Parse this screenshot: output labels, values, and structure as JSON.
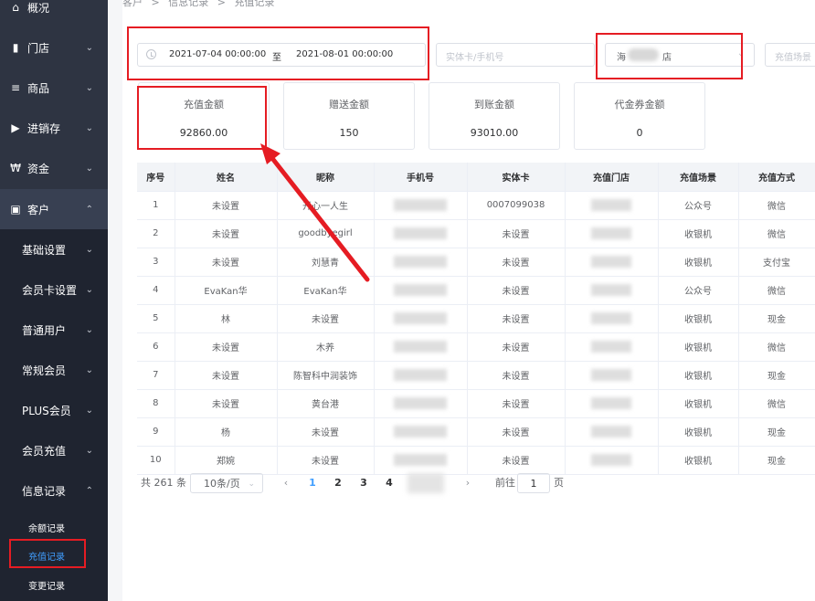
{
  "sidebar": {
    "items": [
      {
        "icon": "home-icon",
        "glyph": "⌂",
        "label": "概况"
      },
      {
        "icon": "store-icon",
        "glyph": "▮",
        "label": "门店",
        "chev": "⌄"
      },
      {
        "icon": "list-icon",
        "glyph": "≡",
        "label": "商品",
        "chev": "⌄"
      },
      {
        "icon": "truck-icon",
        "glyph": "▶",
        "label": "进销存",
        "chev": "⌄"
      },
      {
        "icon": "won-icon",
        "glyph": "₩",
        "label": "资金",
        "chev": "⌄"
      },
      {
        "icon": "id-card-icon",
        "glyph": "▣",
        "label": "客户",
        "chev": "⌃"
      }
    ],
    "sub_items": [
      {
        "label": "基础设置",
        "chev": "⌄"
      },
      {
        "label": "会员卡设置",
        "chev": "⌄"
      },
      {
        "label": "普通用户",
        "chev": "⌄"
      },
      {
        "label": "常规会员",
        "chev": "⌄"
      },
      {
        "label": "PLUS会员",
        "chev": "⌄"
      },
      {
        "label": "会员充值",
        "chev": "⌄"
      },
      {
        "label": "信息记录",
        "chev": "⌃"
      }
    ],
    "leaves": [
      {
        "label": "余额记录"
      },
      {
        "label": "充值记录"
      },
      {
        "label": "变更记录"
      }
    ]
  },
  "breadcrumb": [
    "客户",
    ">",
    "信息记录",
    ">",
    "充值记录"
  ],
  "filters": {
    "date_start": "2021-07-04 00:00:00",
    "date_sep": "至",
    "date_end": "2021-08-01 00:00:00",
    "card_placeholder": "实体卡/手机号",
    "store_value_prefix": "海",
    "store_value_suffix": "店",
    "scene_placeholder": "充值场景"
  },
  "stats": [
    {
      "title": "充值金额",
      "value": "92860.00"
    },
    {
      "title": "赠送金额",
      "value": "150"
    },
    {
      "title": "到账金额",
      "value": "93010.00"
    },
    {
      "title": "代金券金额",
      "value": "0"
    }
  ],
  "table": {
    "headers": [
      "序号",
      "姓名",
      "昵称",
      "手机号",
      "实体卡",
      "充值门店",
      "充值场景",
      "充值方式"
    ],
    "rows": [
      [
        "1",
        "未设置",
        "开心一人生",
        "",
        "0007099038",
        "",
        "公众号",
        "微信"
      ],
      [
        "2",
        "未设置",
        "goodbyegirl",
        "",
        "未设置",
        "",
        "收银机",
        "微信"
      ],
      [
        "3",
        "未设置",
        "刘慧青",
        "",
        "未设置",
        "",
        "收银机",
        "支付宝"
      ],
      [
        "4",
        "EvaKan华",
        "EvaKan华",
        "",
        "未设置",
        "",
        "公众号",
        "微信"
      ],
      [
        "5",
        "林",
        "未设置",
        "",
        "未设置",
        "",
        "收银机",
        "现金"
      ],
      [
        "6",
        "未设置",
        "木养",
        "",
        "未设置",
        "",
        "收银机",
        "微信"
      ],
      [
        "7",
        "未设置",
        "陈智科中润装饰",
        "",
        "未设置",
        "",
        "收银机",
        "现金"
      ],
      [
        "8",
        "未设置",
        "黄台港",
        "",
        "未设置",
        "",
        "收银机",
        "微信"
      ],
      [
        "9",
        "杨",
        "未设置",
        "",
        "未设置",
        "",
        "收银机",
        "现金"
      ],
      [
        "10",
        "郑婉",
        "未设置",
        "",
        "未设置",
        "",
        "收银机",
        "现金"
      ]
    ]
  },
  "pagination": {
    "total": "共 261 条",
    "page_size": "10条/页",
    "pages": [
      "1",
      "2",
      "3",
      "4"
    ],
    "prev": "‹",
    "next": "›",
    "goto_label": "前往",
    "goto_value": "1",
    "goto_suffix": "页"
  },
  "annotation_color": "#e51c23",
  "accent_color": "#409eff"
}
